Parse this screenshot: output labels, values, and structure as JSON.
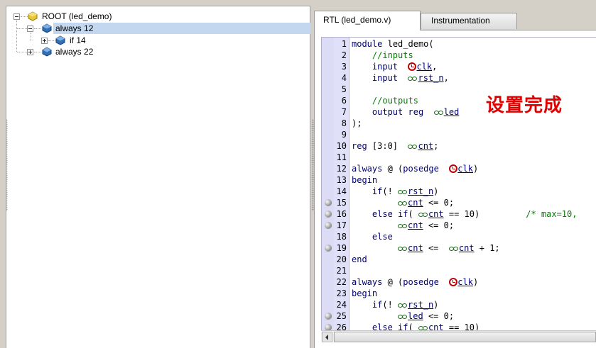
{
  "tree": {
    "root_label": "ROOT (led_demo)",
    "nodes": [
      {
        "label": "always  12",
        "selected": true,
        "expanded": true
      },
      {
        "label": "if  14",
        "selected": false,
        "expanded": false
      },
      {
        "label": "always  22",
        "selected": false,
        "expanded": false
      }
    ]
  },
  "tabs": {
    "active": "RTL (led_demo.v)",
    "inactive": "Instrumentation"
  },
  "overlay": "设置完成",
  "code_lines": [
    {
      "n": "1",
      "text": "module led_demo("
    },
    {
      "n": "2",
      "text": "    //inputs"
    },
    {
      "n": "3",
      "text": "    input  clk,"
    },
    {
      "n": "4",
      "text": "    input  rst_n,"
    },
    {
      "n": "5",
      "text": ""
    },
    {
      "n": "6",
      "text": "    //outputs"
    },
    {
      "n": "7",
      "text": "    output reg  led"
    },
    {
      "n": "8",
      "text": ");"
    },
    {
      "n": "9",
      "text": ""
    },
    {
      "n": "10",
      "text": "reg [3:0]  cnt;"
    },
    {
      "n": "11",
      "text": ""
    },
    {
      "n": "12",
      "text": "always @ (posedge  clk)"
    },
    {
      "n": "13",
      "text": "begin"
    },
    {
      "n": "14",
      "text": "    if(! rst_n)"
    },
    {
      "n": "15",
      "text": "         cnt <= 0;"
    },
    {
      "n": "16",
      "text": "    else if( cnt == 10)         /* max=10,"
    },
    {
      "n": "17",
      "text": "         cnt <= 0;"
    },
    {
      "n": "18",
      "text": "    else"
    },
    {
      "n": "19",
      "text": "         cnt <=  cnt + 1;"
    },
    {
      "n": "20",
      "text": "end"
    },
    {
      "n": "21",
      "text": ""
    },
    {
      "n": "22",
      "text": "always @ (posedge  clk)"
    },
    {
      "n": "23",
      "text": "begin"
    },
    {
      "n": "24",
      "text": "    if(! rst_n)"
    },
    {
      "n": "25",
      "text": "         led <= 0;"
    },
    {
      "n": "26",
      "text": "    else if( cnt == 10)"
    }
  ],
  "colors": {
    "keyword": "#00007a",
    "comment": "#008000",
    "overlay": "#e00000",
    "selection": "#c3d7ef",
    "gutter": "#dcdcf6"
  }
}
